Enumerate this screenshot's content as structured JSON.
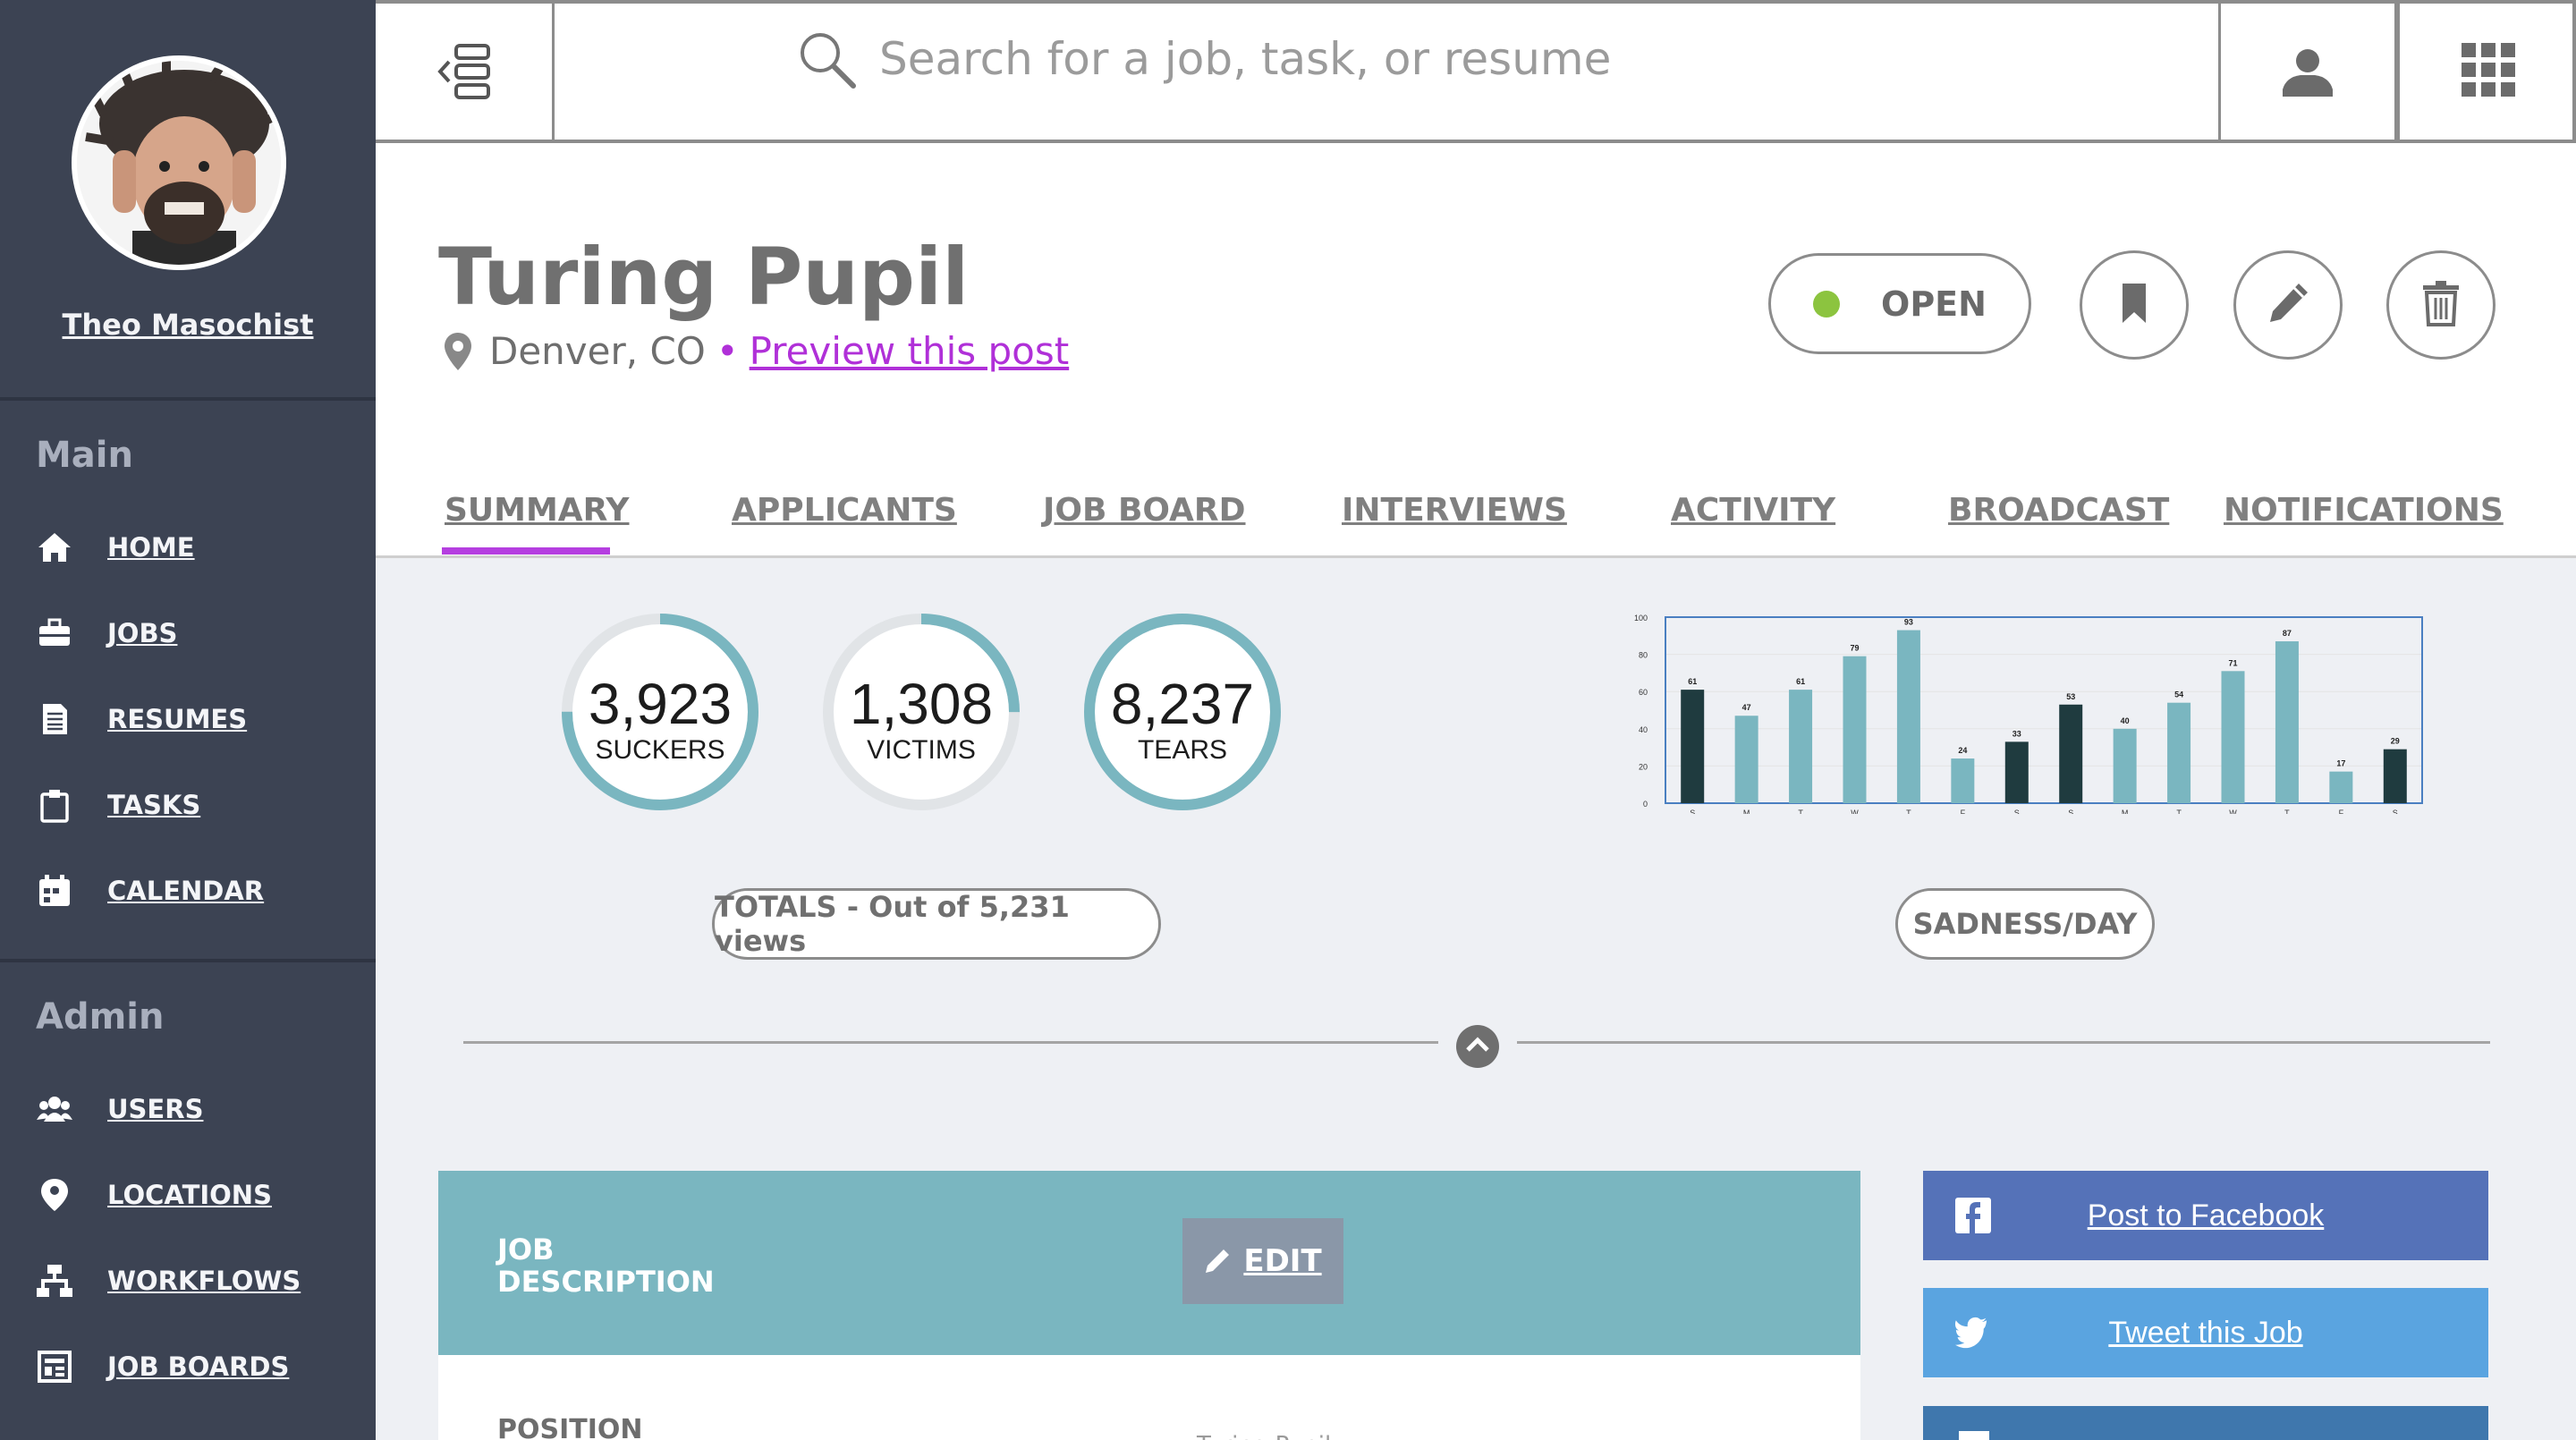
{
  "user": {
    "name": "Theo Masochist"
  },
  "sidebar": {
    "main_heading": "Main",
    "admin_heading": "Admin",
    "main_items": [
      {
        "label": "HOME",
        "icon": "home-icon"
      },
      {
        "label": "JOBS",
        "icon": "briefcase-icon"
      },
      {
        "label": "RESUMES",
        "icon": "document-icon"
      },
      {
        "label": "TASKS",
        "icon": "clipboard-icon"
      },
      {
        "label": "CALENDAR",
        "icon": "calendar-icon"
      }
    ],
    "admin_items": [
      {
        "label": "USERS",
        "icon": "users-icon"
      },
      {
        "label": "LOCATIONS",
        "icon": "location-pin-icon"
      },
      {
        "label": "WORKFLOWS",
        "icon": "workflow-icon"
      },
      {
        "label": "JOB BOARDS",
        "icon": "board-icon"
      }
    ]
  },
  "search": {
    "placeholder": "Search for a job, task, or resume"
  },
  "job": {
    "title": "Turing Pupil",
    "location": "Denver, CO",
    "separator": "•",
    "preview_link": "Preview this post",
    "status": "OPEN",
    "status_color": "#8cc43f"
  },
  "tabs": [
    {
      "label": "SUMMARY",
      "active": true
    },
    {
      "label": "APPLICANTS"
    },
    {
      "label": "JOB BOARD"
    },
    {
      "label": "INTERVIEWS"
    },
    {
      "label": "ACTIVITY"
    },
    {
      "label": "BROADCAST"
    },
    {
      "label": "NOTIFICATIONS"
    }
  ],
  "stats": [
    {
      "value": "3,923",
      "label": "SUCKERS",
      "fraction": 0.75
    },
    {
      "value": "1,308",
      "label": "VICTIMS",
      "fraction": 0.25
    },
    {
      "value": "8,237",
      "label": "TEARS",
      "fraction": 1.0
    }
  ],
  "totals_label": "TOTALS - Out of 5,231 views",
  "chart_label": "SADNESS/DAY",
  "chart_data": {
    "type": "bar",
    "categories": [
      "S",
      "M",
      "T",
      "W",
      "T",
      "F",
      "S",
      "S",
      "M",
      "T",
      "W",
      "T",
      "F",
      "S"
    ],
    "values": [
      61,
      47,
      61,
      79,
      93,
      24,
      33,
      53,
      40,
      54,
      71,
      87,
      17,
      29
    ],
    "weekend": [
      true,
      false,
      false,
      false,
      false,
      false,
      true,
      true,
      false,
      false,
      false,
      false,
      false,
      true
    ],
    "colors": {
      "weekday": "#7ab6c0",
      "weekend": "#1f3b3f"
    },
    "ylim": [
      0,
      100
    ],
    "yticks": [
      0,
      20,
      40,
      60,
      80,
      100
    ],
    "grid": true
  },
  "job_description": {
    "heading": "JOB DESCRIPTION",
    "edit_label": "EDIT",
    "position_label": "POSITION",
    "position_value": "Turing Pupil"
  },
  "share": [
    {
      "label": "Post to Facebook",
      "color": "#5572b8",
      "icon": "facebook-icon"
    },
    {
      "label": "Tweet this Job",
      "color": "#5aa4e0",
      "icon": "twitter-icon"
    }
  ],
  "colors": {
    "accent": "#b53fe0",
    "teal": "#7ab6c0",
    "sidebar": "#3c4353"
  }
}
